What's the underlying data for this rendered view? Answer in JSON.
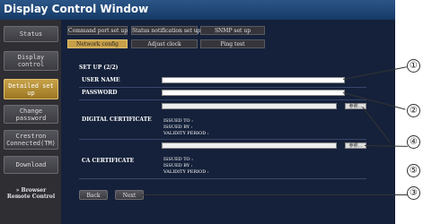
{
  "window": {
    "title": "Display Control Window"
  },
  "sidebar": {
    "items": [
      {
        "label": "Status"
      },
      {
        "label": "Display control"
      },
      {
        "label": "Detailed set up"
      },
      {
        "label": "Change password"
      },
      {
        "label": "Crestron Connected(TM)"
      },
      {
        "label": "Download"
      },
      {
        "label": "» Browser Remote Control"
      }
    ]
  },
  "tabs": {
    "row1": [
      "Command port set up",
      "Status notification set up",
      "SNMP set up"
    ],
    "row2": [
      "Network config",
      "Adjust clock",
      "Ping test"
    ]
  },
  "form": {
    "section_title": "SET UP (2/2)",
    "user_name_label": "USER NAME",
    "password_label": "PASSWORD",
    "digital_certificate_label": "DIGITAL CERTIFICATE",
    "ca_certificate_label": "CA CERTIFICATE",
    "browse_label": "参照...",
    "issued_to": "ISSUED TO :",
    "issued_by": "ISSUED BY :",
    "validity_period": "VALIDITY PERIOD :"
  },
  "buttons": {
    "back": "Back",
    "next": "Next"
  },
  "callouts": [
    "①",
    "②",
    "③",
    "④",
    "⑤"
  ],
  "colors": {
    "accent": "#c8a04a",
    "title_bar": "#1f4a7d",
    "background": "#15213a"
  }
}
